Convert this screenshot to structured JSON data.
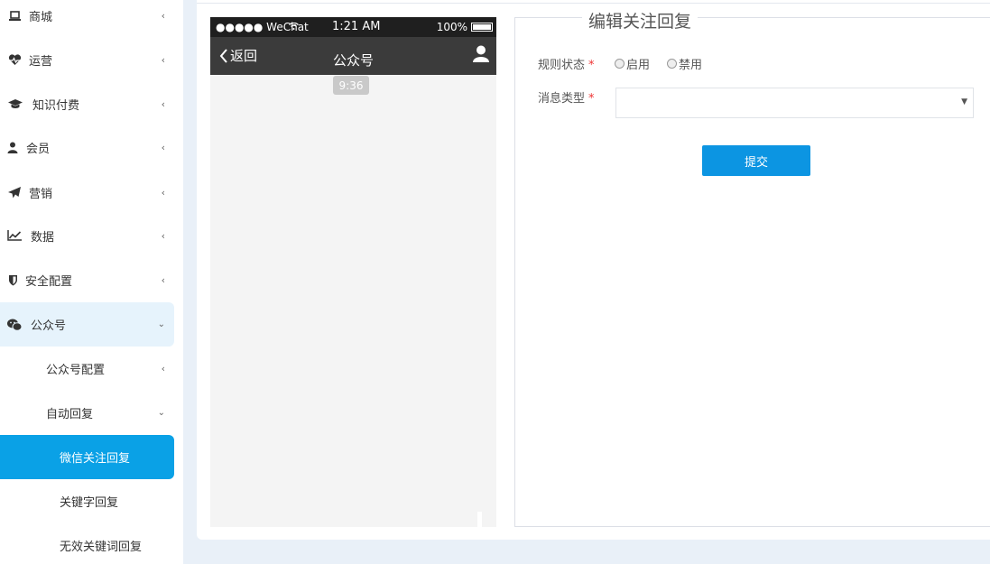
{
  "sidebar": {
    "items": [
      {
        "label": "商城",
        "icon": "laptop-icon"
      },
      {
        "label": "运营",
        "icon": "heartbeat-icon"
      },
      {
        "label": "知识付费",
        "icon": "graduation-cap-icon"
      },
      {
        "label": "会员",
        "icon": "user-icon"
      },
      {
        "label": "营销",
        "icon": "paper-plane-icon"
      },
      {
        "label": "数据",
        "icon": "line-chart-icon"
      },
      {
        "label": "安全配置",
        "icon": "shield-icon"
      },
      {
        "label": "公众号",
        "icon": "wechat-icon"
      }
    ],
    "sub_items": [
      {
        "label": "公众号配置"
      },
      {
        "label": "自动回复"
      }
    ],
    "subsub_items": [
      {
        "label": "微信关注回复"
      },
      {
        "label": "关键字回复"
      },
      {
        "label": "无效关键词回复"
      }
    ]
  },
  "phone": {
    "carrier": "●●●●● WeChat",
    "time": "1:21 AM",
    "battery": "100%",
    "back_label": "返回",
    "title": "公众号",
    "message_time": "9:36"
  },
  "form": {
    "title": "编辑关注回复",
    "status_label": "规则状态",
    "status_options": [
      "启用",
      "禁用"
    ],
    "type_label": "消息类型",
    "type_value": "",
    "submit_label": "提交",
    "required_mark": "*"
  },
  "colors": {
    "accent": "#0aa1e6",
    "submit": "#0c95e2",
    "required": "#e33333"
  }
}
